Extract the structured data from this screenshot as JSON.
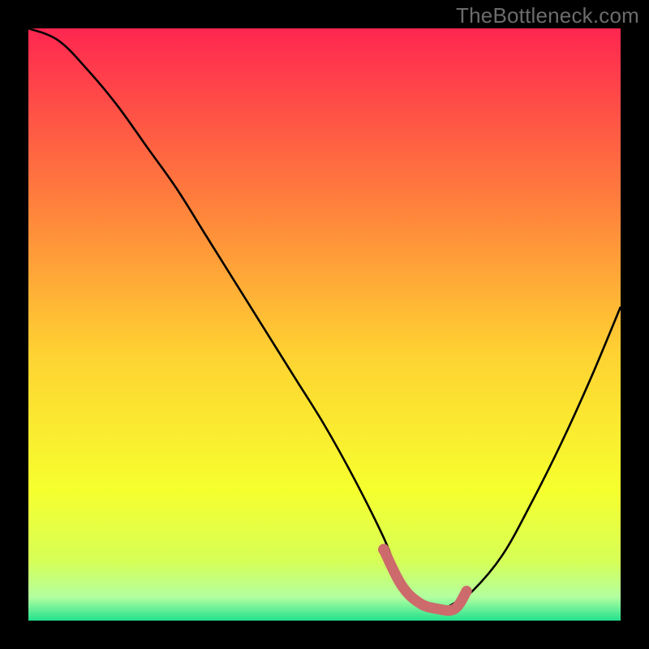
{
  "watermark": "TheBottleneck.com",
  "colors": {
    "bg_black": "#000000",
    "curve": "#000000",
    "dot": "#cd6a6b",
    "grad_top": "#ff2650",
    "grad_mid_upper": "#ff7b3d",
    "grad_mid": "#ffd232",
    "grad_mid_lower": "#f6ff2e",
    "grad_low": "#d6ff57",
    "grad_bottom_pale": "#b3ffa0",
    "grad_bottom": "#22e18e"
  },
  "chart_data": {
    "type": "line",
    "title": "",
    "xlabel": "",
    "ylabel": "",
    "xlim": [
      0,
      100
    ],
    "ylim": [
      0,
      100
    ],
    "series": [
      {
        "name": "bottleneck-curve",
        "x": [
          0,
          5,
          10,
          15,
          20,
          25,
          30,
          35,
          40,
          45,
          50,
          55,
          60,
          62,
          64,
          66,
          68,
          70,
          72,
          75,
          80,
          85,
          90,
          95,
          100
        ],
        "values": [
          100,
          98,
          93,
          87,
          80,
          73,
          65,
          57,
          49,
          41,
          33,
          24,
          14,
          9,
          5,
          3,
          2,
          2,
          3,
          5,
          11,
          20,
          30,
          41,
          53
        ]
      }
    ],
    "highlight_segment": {
      "name": "optimal-band",
      "x": [
        60,
        63,
        66,
        69,
        72,
        74
      ],
      "values": [
        12,
        6,
        3,
        2,
        2,
        5
      ]
    },
    "highlight_dot": {
      "x": 60,
      "value": 12
    }
  }
}
